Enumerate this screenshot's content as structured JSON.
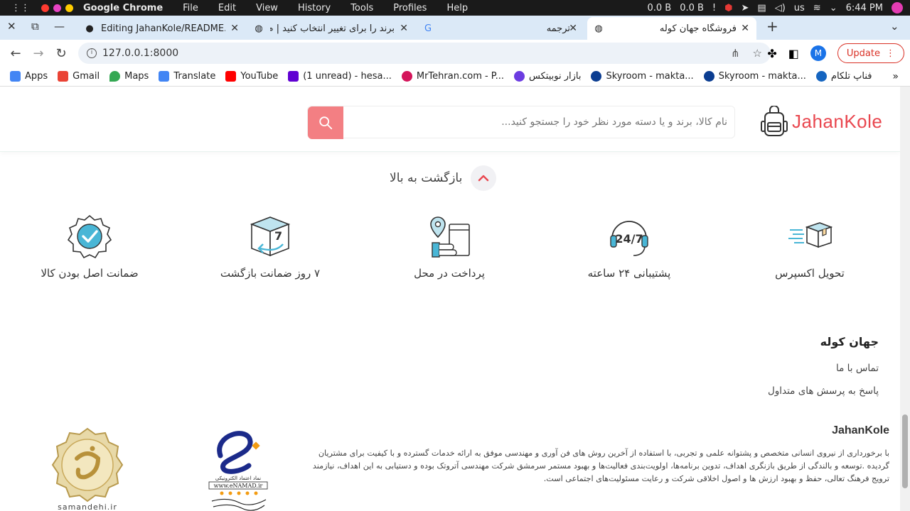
{
  "os": {
    "app_name": "Google Chrome",
    "menu": [
      "File",
      "Edit",
      "View",
      "History",
      "Tools",
      "Profiles",
      "Help"
    ],
    "net_up": "0.0 B",
    "net_down": "0.0 B",
    "keyboard": "us",
    "time": "6:44 PM"
  },
  "tabs": [
    {
      "title": "Editing JahanKole/README.m",
      "icon": "github-icon"
    },
    {
      "title": "برند را برای تغییر انتخاب کنید | م",
      "icon": "globe-icon"
    },
    {
      "title": "ترجمه",
      "icon": "google-translate-icon"
    },
    {
      "title": "فروشگاه جهان کوله",
      "icon": "globe-icon",
      "active": true
    }
  ],
  "address_bar": {
    "url": "127.0.0.1:8000"
  },
  "profile_initial": "M",
  "update_label": "Update",
  "bookmarks": [
    {
      "label": "Apps",
      "icon": "apps-icon",
      "color": "#4285f4"
    },
    {
      "label": "Gmail",
      "icon": "gmail-icon",
      "color": "#ea4335"
    },
    {
      "label": "Maps",
      "icon": "maps-icon",
      "color": "#34a853"
    },
    {
      "label": "Translate",
      "icon": "translate-icon",
      "color": "#4285f4"
    },
    {
      "label": "YouTube",
      "icon": "youtube-icon",
      "color": "#ff0000"
    },
    {
      "label": "(1 unread) - hesa...",
      "icon": "mail-icon",
      "color": "#6001d2"
    },
    {
      "label": "MrTehran.com - P...",
      "icon": "mrtehran-icon",
      "color": "#d4145a"
    },
    {
      "label": "بازار نوبیتکس",
      "icon": "nobitex-icon",
      "color": "#6c3ce1"
    },
    {
      "label": "Skyroom - makta...",
      "icon": "skyroom-icon",
      "color": "#0b3d91"
    },
    {
      "label": "Skyroom - makta...",
      "icon": "skyroom-icon",
      "color": "#0b3d91"
    },
    {
      "label": "فناپ تلکام",
      "icon": "fanap-icon",
      "color": "#1565c0"
    }
  ],
  "site": {
    "logo_text": "JahanKole",
    "search_placeholder": "نام کالا، برند و یا دسته مورد نظر خود را جستجو کنید...",
    "back_to_top": "بازگشت به بالا",
    "features": [
      {
        "label": "تحویل اکسپرس",
        "icon": "express-delivery-icon"
      },
      {
        "label": "پشتیبانی ۲۴ ساعته",
        "icon": "support-24-7-icon"
      },
      {
        "label": "پرداخت در محل",
        "icon": "cash-on-delivery-icon"
      },
      {
        "label": "۷ روز ضمانت بازگشت",
        "icon": "7-day-return-icon"
      },
      {
        "label": "ضمانت اصل بودن کالا",
        "icon": "original-guarantee-icon"
      }
    ],
    "footer": {
      "title": "جهان کوله",
      "links": [
        "تماس با ما",
        "پاسخ به پرسش های متداول"
      ]
    },
    "about": {
      "title": "JahanKole",
      "text": "با برخورداری از نیروی انسانی متخصص و پشتوانه علمی و تجربی، با استفاده از آخرین روش های فن آوری و مهندسی موفق به ارائه خدمات گسترده و با کیفیت برای مشتریان گردیده .توسعه و بالندگی از طریق بازنگری اهداف، تدوین برنامه‌ها، اولویت‌بندی فعالیت‌ها و بهبود مستمر سرمشق شرکت مهندسی آتروتک بوده و دستیابی به این اهداف، نیازمند ترویج فرهنگ تعالی، حفظ و بهبود ارزش ها و اصول اخلاقی شرکت و رعایت مسئولیت‌های اجتماعی است."
    },
    "badges": {
      "enamad_site": "www.eNAMAD.ir",
      "enamad_caption": "نماد اعتماد الکترونیکی",
      "samandehi": "samandehi.ir"
    }
  }
}
